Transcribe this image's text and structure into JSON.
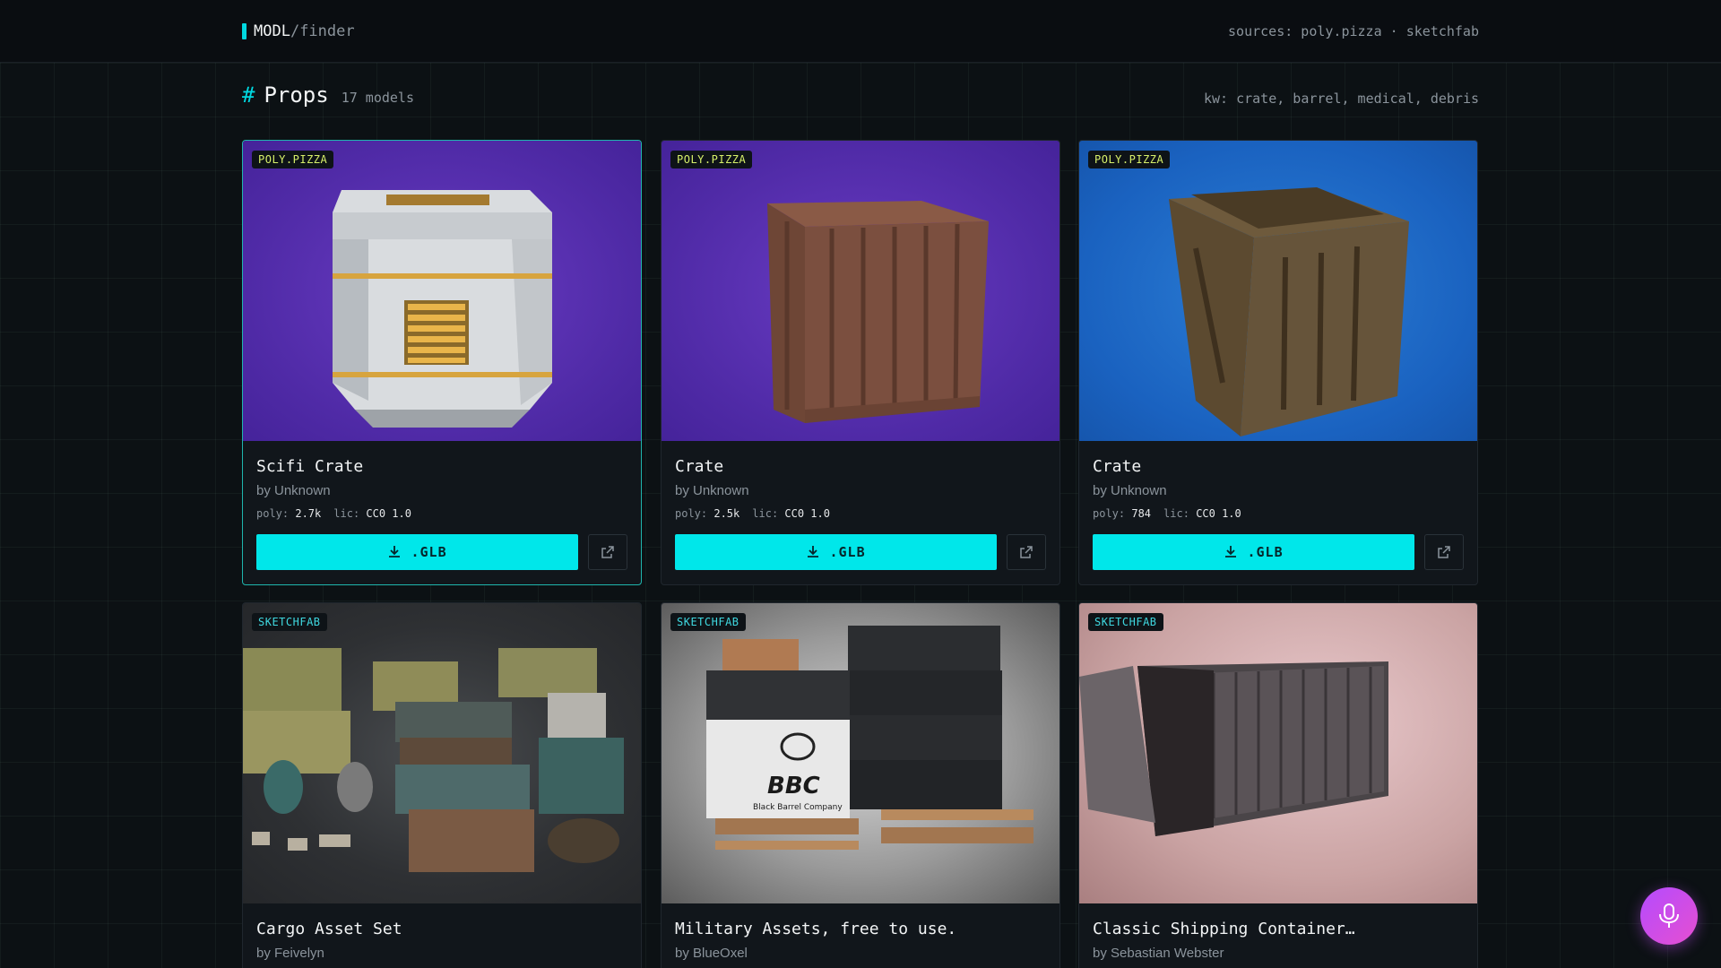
{
  "header": {
    "brand_main": "MODL",
    "brand_sub": "/finder",
    "sources": "sources: poly.pizza · sketchfab"
  },
  "section": {
    "hash": "#",
    "title": "Props",
    "count": "17 models",
    "keywords": "kw: crate, barrel, medical, debris"
  },
  "labels": {
    "poly": "poly:",
    "lic": "lic:",
    "download": ".GLB"
  },
  "cards": [
    {
      "source": "POLY.PIZZA",
      "title": "Scifi Crate",
      "author": "by Unknown",
      "poly": "2.7k",
      "lic": "CC0 1.0"
    },
    {
      "source": "POLY.PIZZA",
      "title": "Crate",
      "author": "by Unknown",
      "poly": "2.5k",
      "lic": "CC0 1.0"
    },
    {
      "source": "POLY.PIZZA",
      "title": "Crate",
      "author": "by Unknown",
      "poly": "784",
      "lic": "CC0 1.0"
    },
    {
      "source": "SKETCHFAB",
      "title": "Cargo Asset Set",
      "author": "by Feivelyn"
    },
    {
      "source": "SKETCHFAB",
      "title": "Military Assets, free to use.",
      "author": "by BlueOxel",
      "logo_text": "BBC",
      "logo_sub": "Black Barrel Company"
    },
    {
      "source": "SKETCHFAB",
      "title": "Classic Shipping Container…",
      "author": "by Sebastian Webster"
    }
  ],
  "colors": {
    "accent": "#00e7ea",
    "poly_badge": "#d7f06a",
    "sketch_badge": "#3fd8e0",
    "mic_gradient": [
      "#b44bff",
      "#e64fd0"
    ]
  },
  "icons": {
    "download": "download-icon",
    "external": "external-link-icon",
    "mic": "microphone-icon"
  }
}
